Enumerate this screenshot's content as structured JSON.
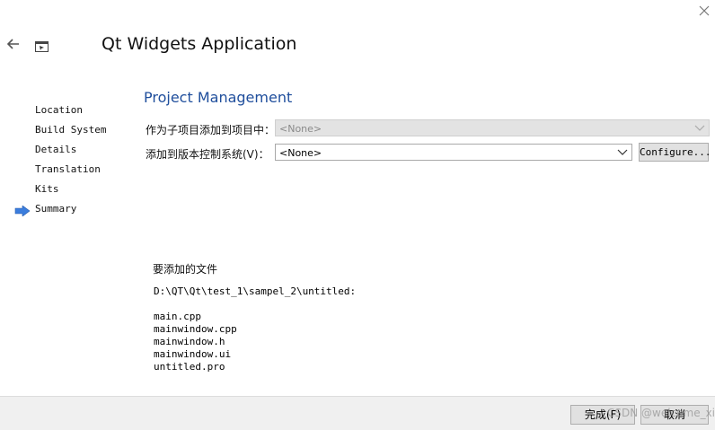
{
  "window": {
    "title": "Qt Widgets Application",
    "close_icon": "close-icon",
    "back_icon": "back-arrow-icon",
    "app_icon": "qt-app-icon"
  },
  "steps": [
    {
      "label": "Location"
    },
    {
      "label": "Build System"
    },
    {
      "label": "Details"
    },
    {
      "label": "Translation"
    },
    {
      "label": "Kits"
    },
    {
      "label": "Summary",
      "current": true
    }
  ],
  "project_management": {
    "title": "Project Management",
    "subproject_label": "作为子项目添加到项目中：",
    "subproject_value": "<None>",
    "vcs_label": "添加到版本控制系统(V)：",
    "vcs_value": "<None>",
    "configure_label": "Configure..."
  },
  "files": {
    "heading": "要添加的文件",
    "path": "D:\\QT\\Qt\\test_1\\sampel_2\\untitled:",
    "items": [
      "main.cpp",
      "mainwindow.cpp",
      "mainwindow.h",
      "mainwindow.ui",
      "untitled.pro"
    ]
  },
  "buttons": {
    "finish": "完成(F)",
    "cancel": "取消"
  },
  "watermark": "CSDN @welcome_xian",
  "colors": {
    "section_title": "#1f4e9c",
    "current_step_arrow": "#3b7ddd",
    "bottom_bar": "#f0f0f0"
  }
}
